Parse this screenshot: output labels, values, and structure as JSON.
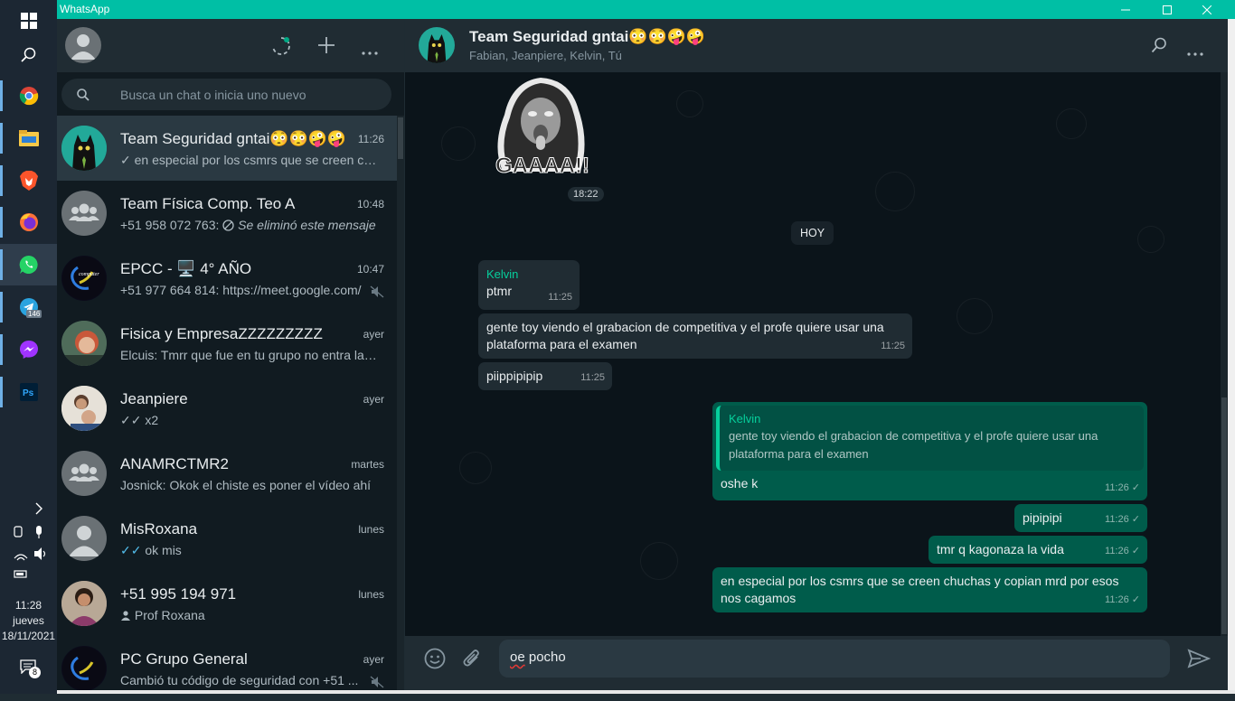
{
  "window": {
    "title": "WhatsApp"
  },
  "taskbar": {
    "apps": [
      "windows-start",
      "search",
      "chrome",
      "file-explorer",
      "brave",
      "firefox",
      "whatsapp",
      "telegram",
      "messenger",
      "photoshop"
    ],
    "telegram_badge": "146",
    "clock": {
      "time": "11:28",
      "day": "jueves",
      "date": "18/11/2021"
    },
    "notification_count": "8"
  },
  "sidebar": {
    "search_placeholder": "Busca un chat o inicia uno nuevo",
    "chats": [
      {
        "name": "Team Seguridad gntai😳😳🤪🤪",
        "time": "11:26",
        "preview": "✓ en especial por los csmrs que se creen chuchas y copian mrd por esos nos cagamos",
        "selected": true
      },
      {
        "name": "Team Física Comp. Teo A",
        "time": "10:48",
        "preview_prefix": "+51 958 072 763: ",
        "preview_deleted": "Se eliminó este mensaje"
      },
      {
        "name": "EPCC - 🖥️ 4° AÑO",
        "time": "10:47",
        "preview": "+51 977 664 814: https://meet.google.com/",
        "muted": true
      },
      {
        "name": "Fisica y EmpresaZZZZZZZZZ",
        "time": "ayer",
        "preview": "Elcuis: Tmrr que fue en tu grupo no entra la pregunta"
      },
      {
        "name": "Jeanpiere",
        "time": "ayer",
        "preview": "✓✓ x2"
      },
      {
        "name": "ANAMRCTMR2",
        "time": "martes",
        "preview": "Josnick: Okok el chiste es poner el vídeo ahí"
      },
      {
        "name": "MisRoxana",
        "time": "lunes",
        "preview": "ok mis",
        "read_ticks": "✓✓"
      },
      {
        "name": "+51 995 194 971",
        "time": "lunes",
        "preview": "Prof Roxana"
      },
      {
        "name": "PC Grupo General",
        "time": "ayer",
        "preview": "Cambió tu código de seguridad con +51 ...",
        "muted": true
      }
    ]
  },
  "conversation": {
    "title": "Team Seguridad gntai😳😳🤪🤪",
    "members": "Fabian, Jeanpiere, Kelvin, Tú",
    "sticker_text": "GAAAA!!",
    "sticker_time": "18:22",
    "date_divider": "HOY",
    "messages": [
      {
        "dir": "in",
        "sender": "Kelvin",
        "text": "ptmr",
        "time": "11:25"
      },
      {
        "dir": "in",
        "text": "gente toy viendo el grabacion de competitiva y el profe quiere usar una plataforma para el examen",
        "time": "11:25"
      },
      {
        "dir": "in",
        "text": "piippipipip",
        "time": "11:25"
      },
      {
        "dir": "out",
        "quote_sender": "Kelvin",
        "quote_text": "gente toy viendo el grabacion de competitiva y el profe quiere usar una plataforma para el examen",
        "text": "oshe k",
        "time": "11:26 ✓"
      },
      {
        "dir": "out",
        "text": "pipipipi",
        "time": "11:26 ✓"
      },
      {
        "dir": "out",
        "text": "tmr q kagonaza la vida",
        "time": "11:26 ✓"
      },
      {
        "dir": "out",
        "text": "en especial por los csmrs que se creen chuchas y copian mrd por esos nos cagamos",
        "time": "11:26 ✓"
      }
    ],
    "composer": {
      "value_word1": "oe",
      "value_rest": " pocho"
    }
  },
  "colors": {
    "accent": "#00bfa5",
    "outgoing": "#005c4b",
    "incoming": "#202c33",
    "panel": "#111b21"
  }
}
